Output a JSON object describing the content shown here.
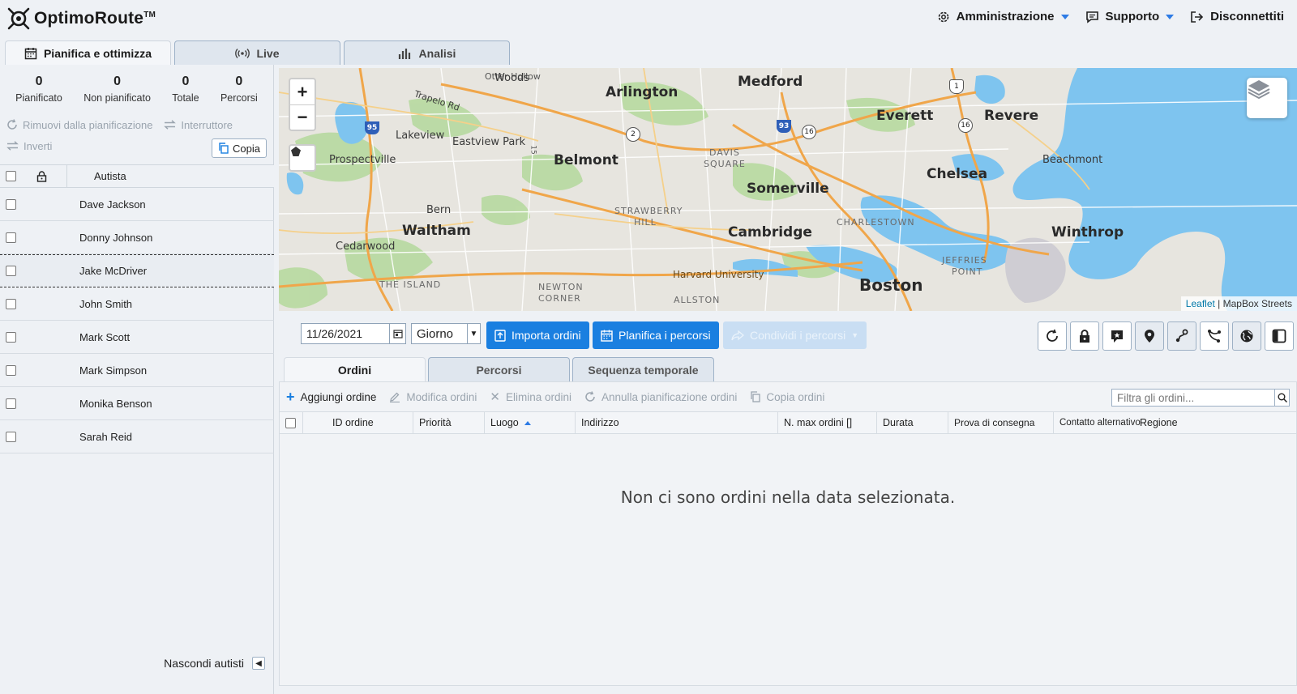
{
  "brand": {
    "name": "OptimoRoute",
    "tm": "TM"
  },
  "top_nav": {
    "admin": "Amministrazione",
    "support": "Supporto",
    "logout": "Disconnettiti"
  },
  "main_tabs": [
    {
      "label": "Pianifica e ottimizza",
      "icon": "calendar-icon",
      "active": true
    },
    {
      "label": "Live",
      "icon": "broadcast-icon",
      "active": false
    },
    {
      "label": "Analisi",
      "icon": "bar-chart-icon",
      "active": false
    }
  ],
  "stats": [
    {
      "value": "0",
      "label": "Pianificato"
    },
    {
      "value": "0",
      "label": "Non pianificato"
    },
    {
      "value": "0",
      "label": "Totale"
    },
    {
      "value": "0",
      "label": "Percorsi"
    }
  ],
  "driver_actions": {
    "remove": "Rimuovi dalla pianificazione",
    "switch": "Interruttore",
    "invert": "Inverti",
    "copy": "Copia"
  },
  "driver_table": {
    "header": "Autista",
    "rows": [
      {
        "name": "Dave Jackson"
      },
      {
        "name": "Donny Johnson"
      },
      {
        "name": "Jake McDriver"
      },
      {
        "name": "John Smith"
      },
      {
        "name": "Mark Scott"
      },
      {
        "name": "Mark Simpson"
      },
      {
        "name": "Monika Benson"
      },
      {
        "name": "Sarah Reid"
      }
    ]
  },
  "hide_drivers": "Nascondi autisti",
  "map": {
    "zoom_in": "+",
    "zoom_out": "−",
    "labels": {
      "arlington": "Arlington",
      "medford": "Medford",
      "everett": "Everett",
      "revere": "Revere",
      "belmont": "Belmont",
      "somerville": "Somerville",
      "chelsea": "Chelsea",
      "waltham": "Waltham",
      "cambridge": "Cambridge",
      "winthrop": "Winthrop",
      "boston": "Boston",
      "lakeview": "Lakeview",
      "eastview_park": "Eastview Park",
      "prospectville": "Prospectville",
      "cedarwood": "Cedarwood",
      "beachmont": "Beachmont",
      "harvard": "Harvard University",
      "woods": "Woods",
      "other_woods": "Otter Hollow",
      "trapelo": "Trapelo Rd",
      "davis": "DAVIS",
      "square": "SQUARE",
      "strawberry": "STRAWBERRY",
      "hill": "HILL",
      "charlestown": "CHARLESTOWN",
      "jeffries": "JEFFRIES",
      "point": "POINT",
      "the_island": "THE ISLAND",
      "newton": "NEWTON",
      "corner": "CORNER",
      "allston": "ALLSTON",
      "bern": "Bern",
      "rt95": "95",
      "rt93": "93",
      "rt2": "2",
      "rt16a": "16",
      "rt16b": "16",
      "rt1": "1",
      "rt15": "15"
    },
    "attribution_link": "Leaflet",
    "attribution_sep": " | ",
    "attribution_text": "MapBox Streets"
  },
  "toolbar": {
    "date": "11/26/2021",
    "period": "Giorno",
    "import": "Importa ordini",
    "plan": "Planifica i percorsi",
    "share": "Condividi i percorsi",
    "icons": [
      "refresh-icon",
      "lock-icon",
      "comment-icon",
      "map-pin-icon",
      "route-icon",
      "branch-icon",
      "globe-icon",
      "panel-icon"
    ]
  },
  "sub_tabs": [
    {
      "label": "Ordini",
      "active": true
    },
    {
      "label": "Percorsi",
      "active": false
    },
    {
      "label": "Sequenza temporale",
      "active": false
    }
  ],
  "orders_actions": {
    "add": "Aggiungi ordine",
    "edit": "Modifica ordini",
    "delete": "Elimina ordini",
    "unschedule": "Annulla pianificazione ordini",
    "copy": "Copia ordini",
    "filter_placeholder": "Filtra gli ordini..."
  },
  "orders_columns": [
    "ID ordine",
    "Priorità",
    "Luogo",
    "Indirizzo",
    "N. max ordini []",
    "Durata",
    "Prova di consegna",
    "Contatto alternativo",
    "Regione"
  ],
  "empty_message": "Non ci sono ordini nella data selezionata.",
  "colors": {
    "accent": "#1a7fe0",
    "water": "#7ec4ef",
    "park": "#b7d9a0",
    "highway": "#f0a64a"
  }
}
